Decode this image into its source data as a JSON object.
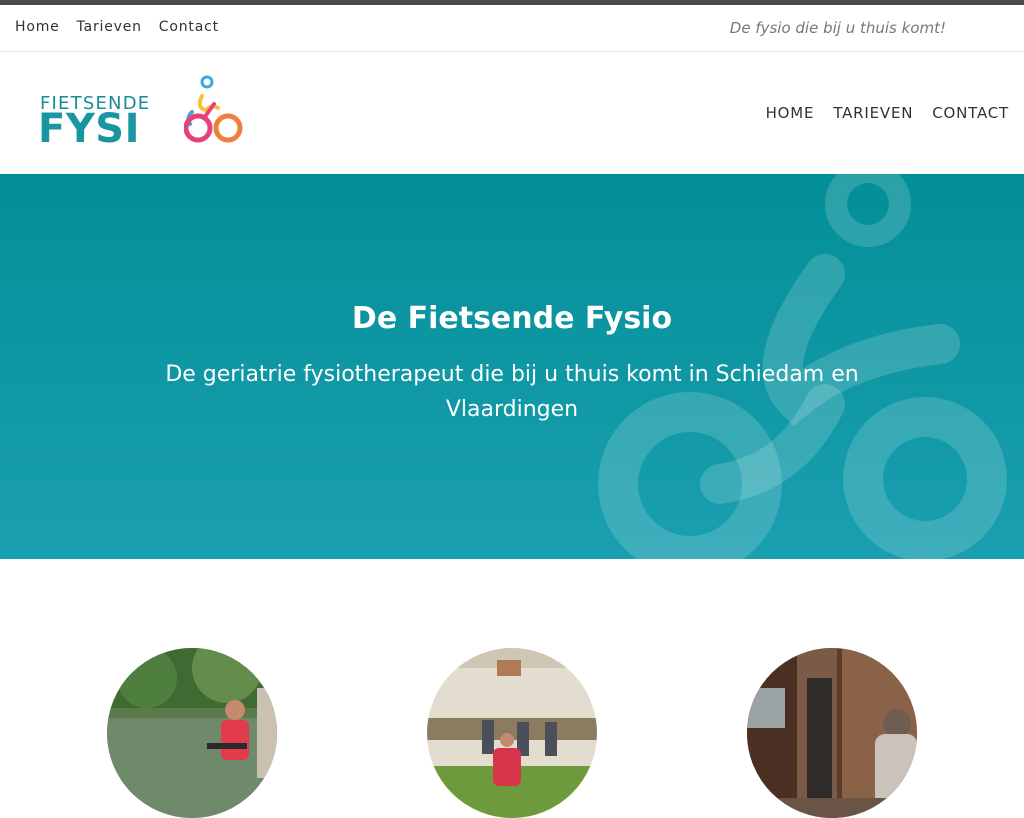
{
  "topbar": {
    "nav": [
      "Home",
      "Tarieven",
      "Contact"
    ],
    "tagline": "De fysio die bij u thuis komt!"
  },
  "logo": {
    "line1": "FIETSENDE",
    "line2": "FYSI"
  },
  "main_nav": [
    "HOME",
    "TARIEVEN",
    "CONTACT"
  ],
  "hero": {
    "title": "De Fietsende Fysio",
    "subtitle": "De geriatrie fysiotherapeut die bij u thuis komt in Schiedam en Vlaardingen"
  },
  "colors": {
    "brand_teal": "#038f97",
    "hero_bottom": "#1a9fb0",
    "logo_pink": "#e8407a",
    "logo_orange": "#f07f3c",
    "logo_yellow": "#f5c33b",
    "logo_blue": "#3fa9dd"
  },
  "features": [
    {
      "image": "photo-cycling-woman"
    },
    {
      "image": "photo-gym-exercise"
    },
    {
      "image": "photo-street-visit"
    }
  ]
}
